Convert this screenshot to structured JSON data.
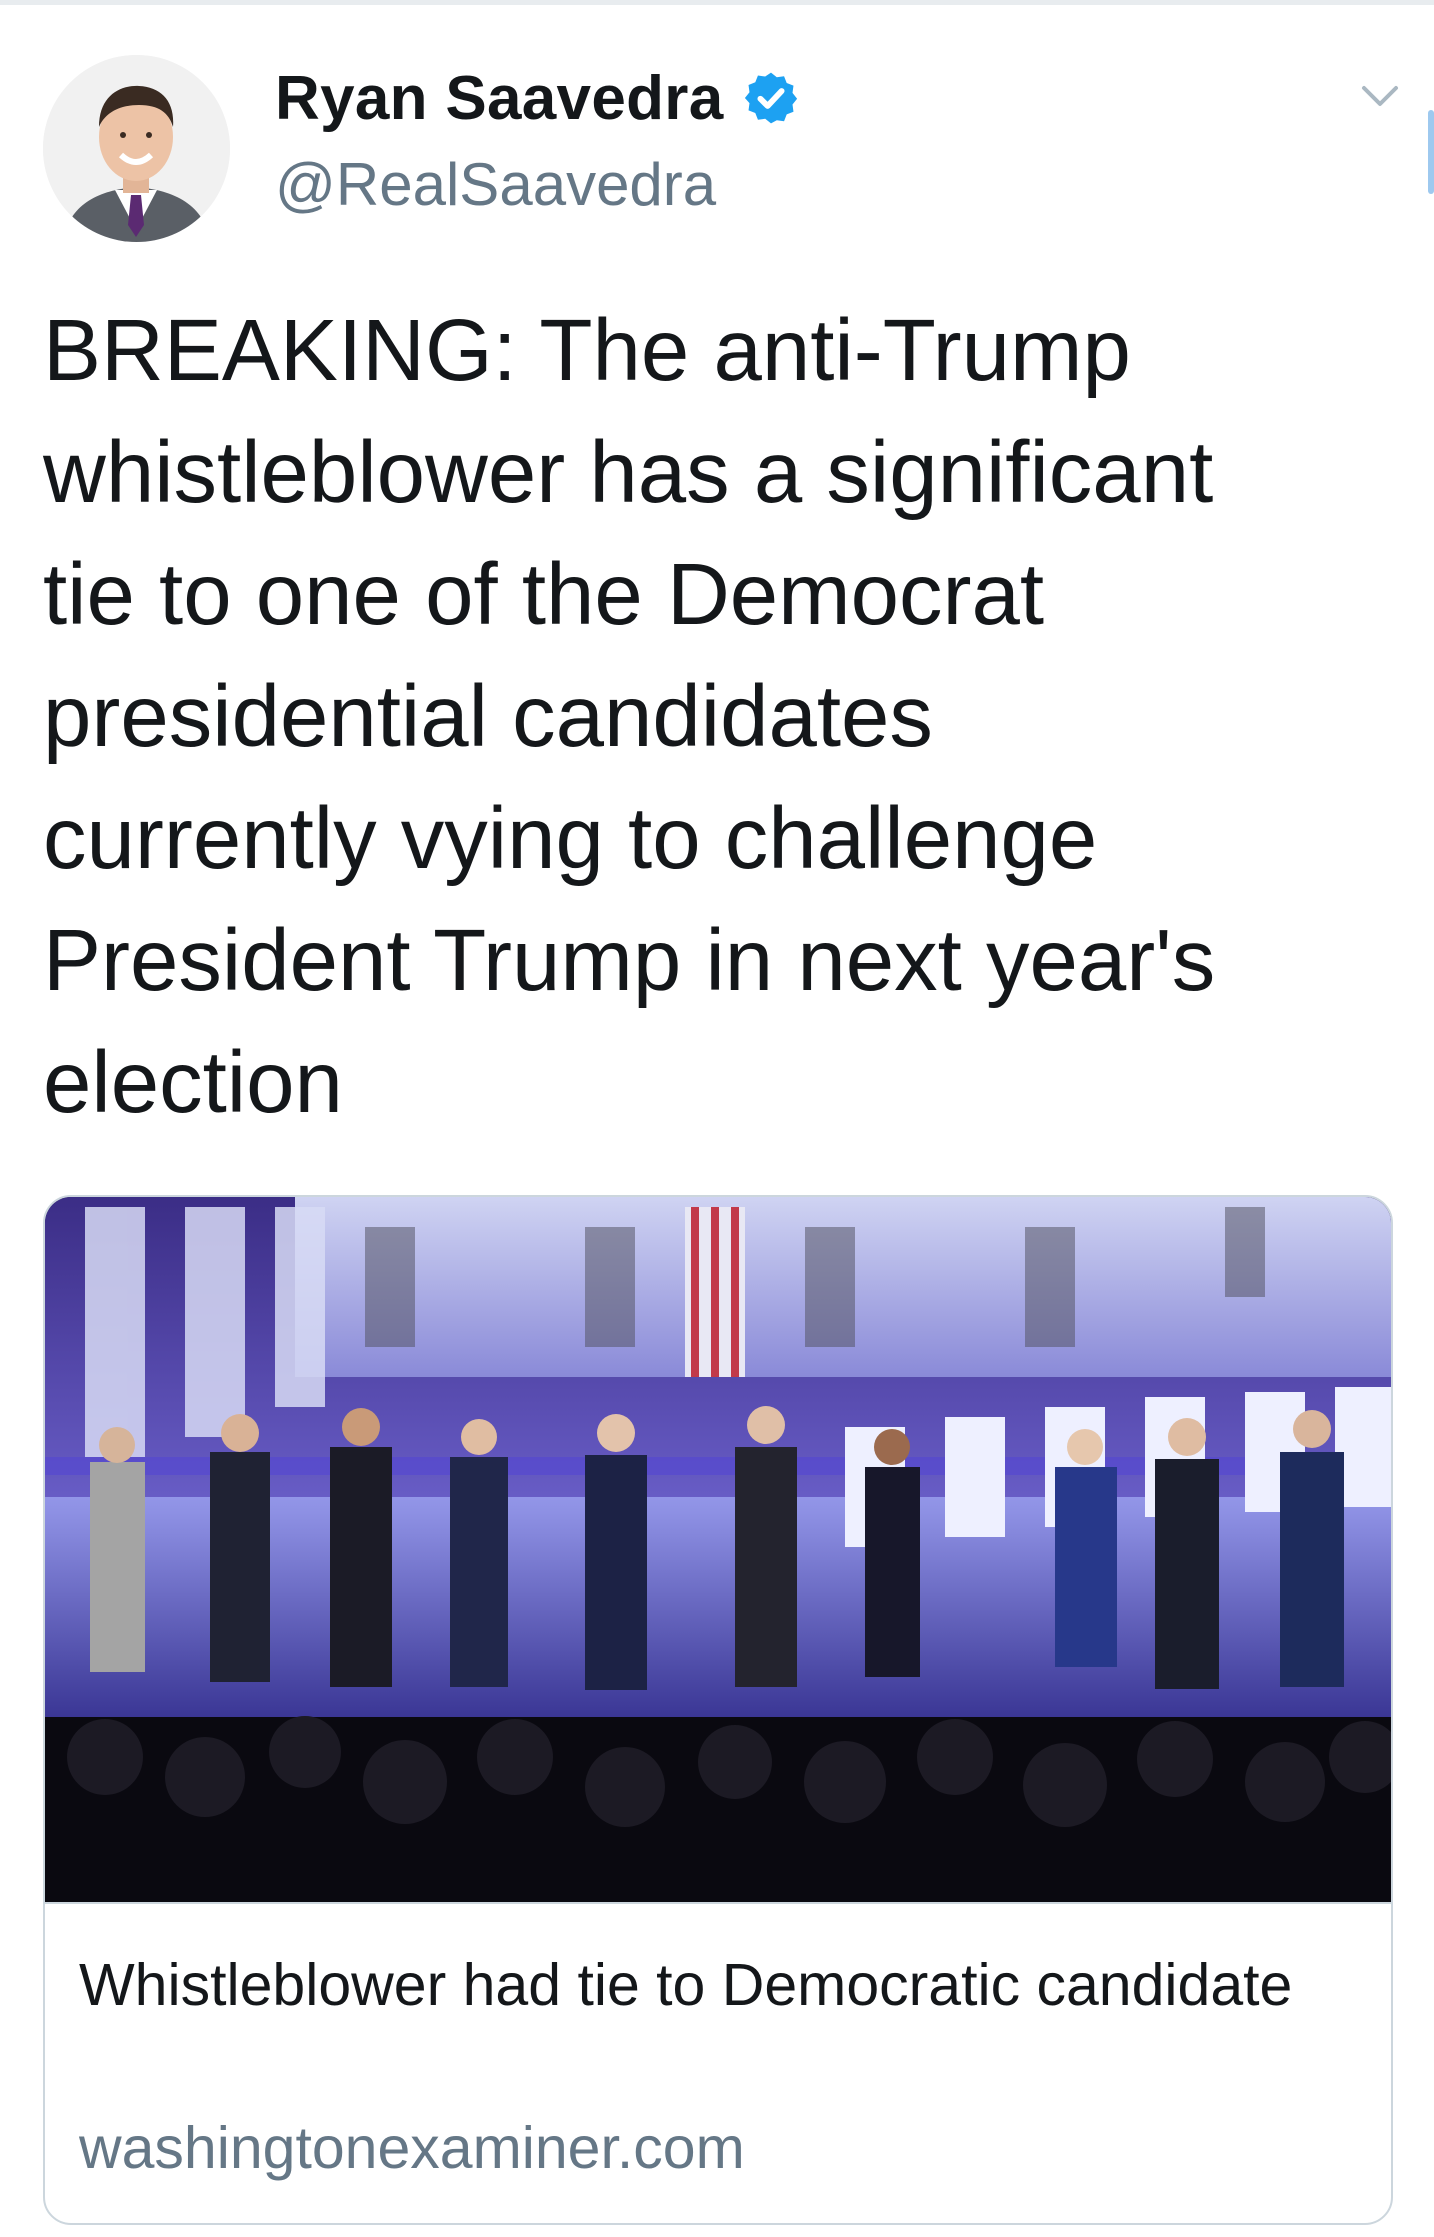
{
  "tweet": {
    "author": {
      "display_name": "Ryan Saavedra",
      "handle": "@RealSaavedra",
      "verified": true,
      "avatar_icon": "profile-photo"
    },
    "text": "BREAKING: The anti-Trump\nwhistleblower has a significant\ntie to one of the Democrat\npresidential candidates\ncurrently vying to challenge\nPresident Trump in next year's\nelection",
    "menu_icon": "chevron-down-icon"
  },
  "card": {
    "image_icon": "debate-stage-photo",
    "title": "Whistleblower had tie to Democratic candidate",
    "domain": "washingtonexaminer.com"
  },
  "colors": {
    "text_primary": "#14171a",
    "text_secondary": "#657786",
    "verified_blue": "#1da1f2",
    "card_border": "#ccd6dd"
  }
}
